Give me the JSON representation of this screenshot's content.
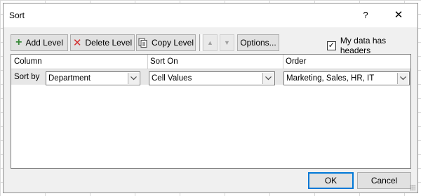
{
  "dialog": {
    "title": "Sort",
    "help": "?",
    "close": "✕"
  },
  "toolbar": {
    "add_level": "Add Level",
    "delete_level": "Delete Level",
    "copy_level": "Copy Level",
    "move_up": "▲",
    "move_down": "▼",
    "options": "Options...",
    "headers_label": "My data has headers",
    "headers_checked": "✓"
  },
  "grid": {
    "headers": [
      "Column",
      "Sort On",
      "Order"
    ],
    "row": {
      "label": "Sort by",
      "column": "Department",
      "sort_on": "Cell Values",
      "order": "Marketing, Sales, HR, IT"
    }
  },
  "footer": {
    "ok": "OK",
    "cancel": "Cancel"
  },
  "colors": {
    "accent": "#0078d7",
    "add_icon": "#3a8a3a",
    "delete_icon": "#d22b2b"
  }
}
